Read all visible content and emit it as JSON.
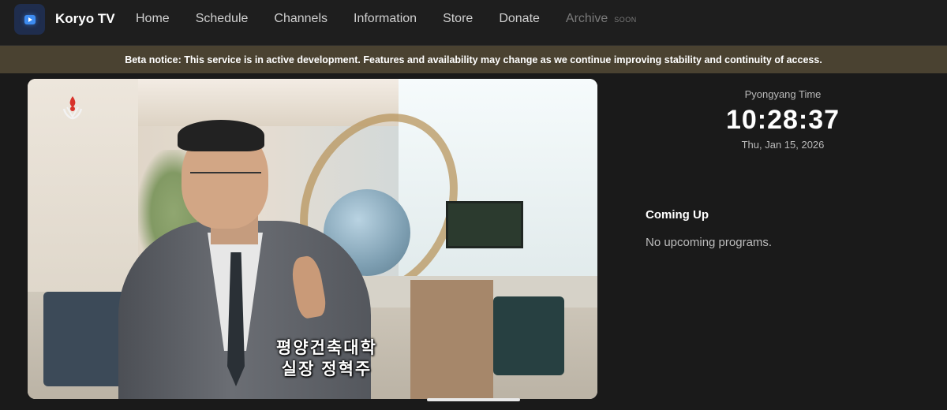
{
  "brand": {
    "name": "Koryo TV",
    "icon": "play-icon",
    "accent": "#3d8bf0"
  },
  "nav": {
    "items": [
      {
        "label": "Home"
      },
      {
        "label": "Schedule"
      },
      {
        "label": "Channels"
      },
      {
        "label": "Information"
      },
      {
        "label": "Store"
      },
      {
        "label": "Donate"
      }
    ],
    "archive": {
      "label": "Archive",
      "badge": "SOON"
    }
  },
  "notice": {
    "text": "Beta notice: This service is in active development. Features and availability may change as we continue improving stability and continuity of access.",
    "background": "#4a4231"
  },
  "player": {
    "caption_line1": "평양건축대학",
    "caption_line2": "실장 정혁주"
  },
  "clock": {
    "label": "Pyongyang Time",
    "time": "10:28:37",
    "date": "Thu, Jan 15, 2026"
  },
  "upcoming": {
    "title": "Coming Up",
    "empty_text": "No upcoming programs."
  }
}
